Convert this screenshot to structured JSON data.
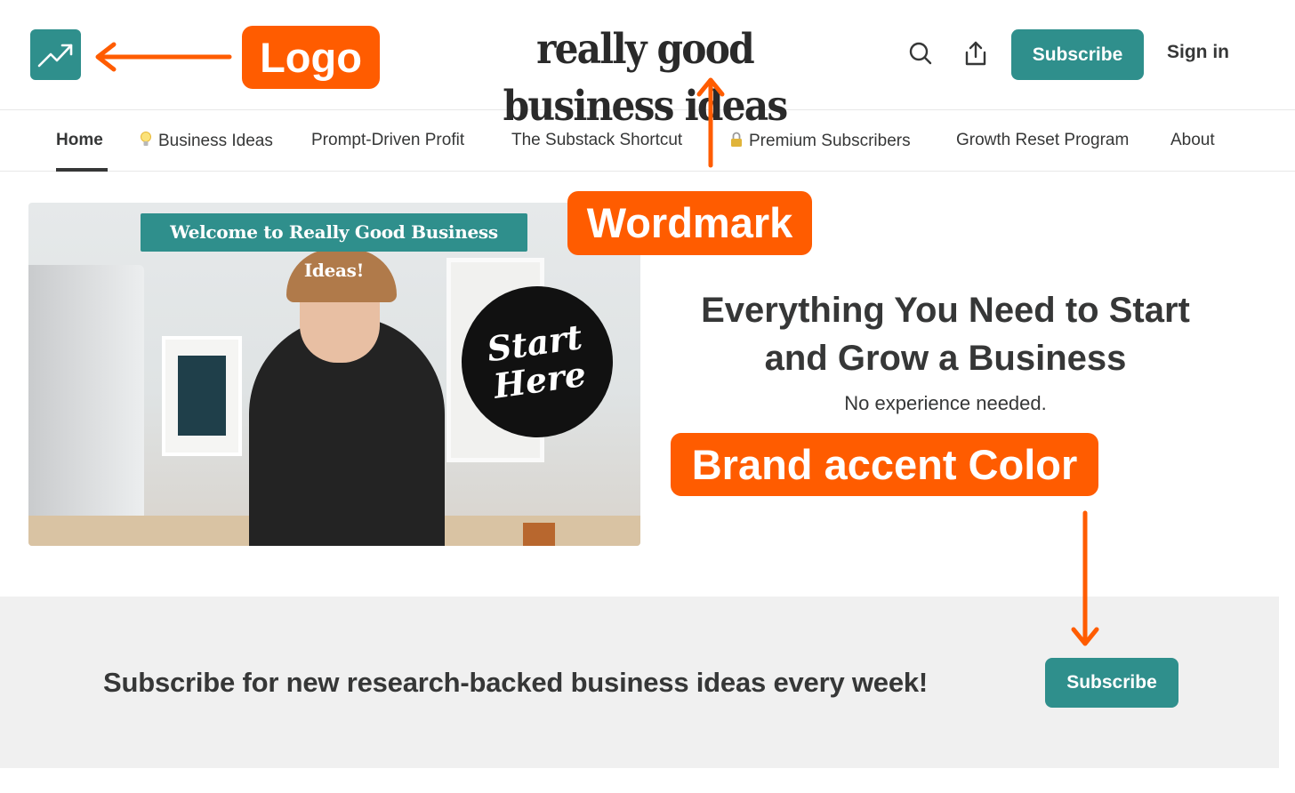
{
  "colors": {
    "brand_accent": "#2f8f8c",
    "annotation": "#ff5c00",
    "text": "#363737",
    "band_bg": "#f0f0f0"
  },
  "header": {
    "logo_icon": "trending-up-icon",
    "wordmark": "really good business ideas",
    "search_icon": "search-icon",
    "share_icon": "share-icon",
    "subscribe_label": "Subscribe",
    "signin_label": "Sign in"
  },
  "nav": {
    "items": [
      {
        "label": "Home",
        "active": true
      },
      {
        "label": "Business Ideas",
        "icon": "lightbulb-icon"
      },
      {
        "label": "Prompt-Driven Profit"
      },
      {
        "label": "The Substack Shortcut"
      },
      {
        "label": "Premium Subscribers",
        "icon": "lock-icon"
      },
      {
        "label": "Growth Reset Program"
      },
      {
        "label": "About"
      }
    ]
  },
  "hero": {
    "image_banner": "Welcome to Really Good Business Ideas!",
    "badge_line1": "Start",
    "badge_line2": "Here",
    "title_line1": "Everything You Need to Start",
    "title_line2": "and Grow a Business",
    "subtitle": "No experience needed."
  },
  "subscribe_band": {
    "text": "Subscribe for new research-backed business ideas every week!",
    "button_label": "Subscribe"
  },
  "annotations": {
    "logo": "Logo",
    "wordmark": "Wordmark",
    "accent": "Brand accent Color"
  }
}
